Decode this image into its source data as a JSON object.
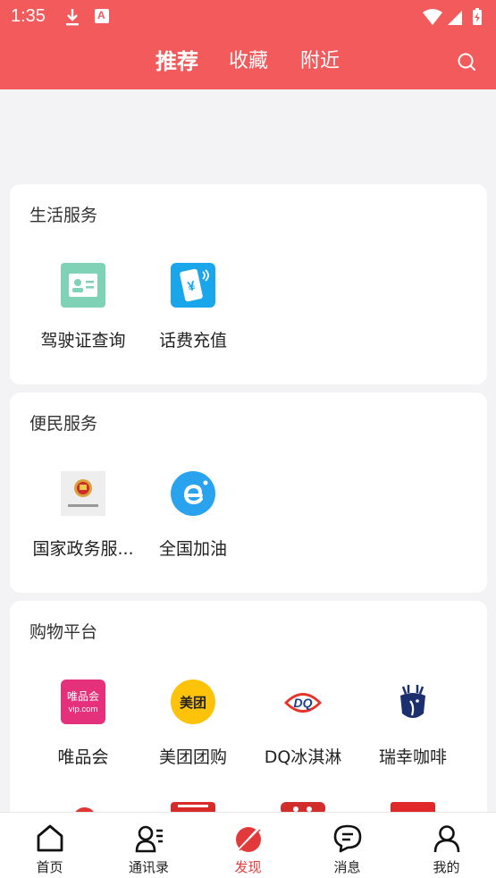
{
  "status": {
    "time": "1:35"
  },
  "header": {
    "tabs": [
      {
        "label": "推荐",
        "active": true
      },
      {
        "label": "收藏",
        "active": false
      },
      {
        "label": "附近",
        "active": false
      }
    ]
  },
  "sections": [
    {
      "title": "生活服务",
      "items": [
        {
          "label": "驾驶证查询",
          "icon": "id-card-icon"
        },
        {
          "label": "话费充值",
          "icon": "phone-yuan-icon"
        }
      ]
    },
    {
      "title": "便民服务",
      "items": [
        {
          "label": "国家政务服...",
          "icon": "government-emblem-icon"
        },
        {
          "label": "全国加油",
          "icon": "e-logo-icon"
        }
      ]
    },
    {
      "title": "购物平台",
      "items": [
        {
          "label": "唯品会",
          "icon": "vip-logo",
          "logo_text": "唯品会",
          "logo_sub": "vip.com"
        },
        {
          "label": "美团团购",
          "icon": "meituan-logo",
          "logo_text": "美团"
        },
        {
          "label": "DQ冰淇淋",
          "icon": "dq-logo",
          "logo_text": "DQ"
        },
        {
          "label": "瑞幸咖啡",
          "icon": "luckin-deer-logo"
        }
      ]
    }
  ],
  "bottom_nav": [
    {
      "label": "首页",
      "icon": "home-icon",
      "active": false
    },
    {
      "label": "通讯录",
      "icon": "contacts-icon",
      "active": false
    },
    {
      "label": "发现",
      "icon": "discover-icon",
      "active": true
    },
    {
      "label": "消息",
      "icon": "message-icon",
      "active": false
    },
    {
      "label": "我的",
      "icon": "profile-icon",
      "active": false
    }
  ],
  "colors": {
    "header_red": "#f25a5b",
    "active_red": "#e23a3a"
  }
}
